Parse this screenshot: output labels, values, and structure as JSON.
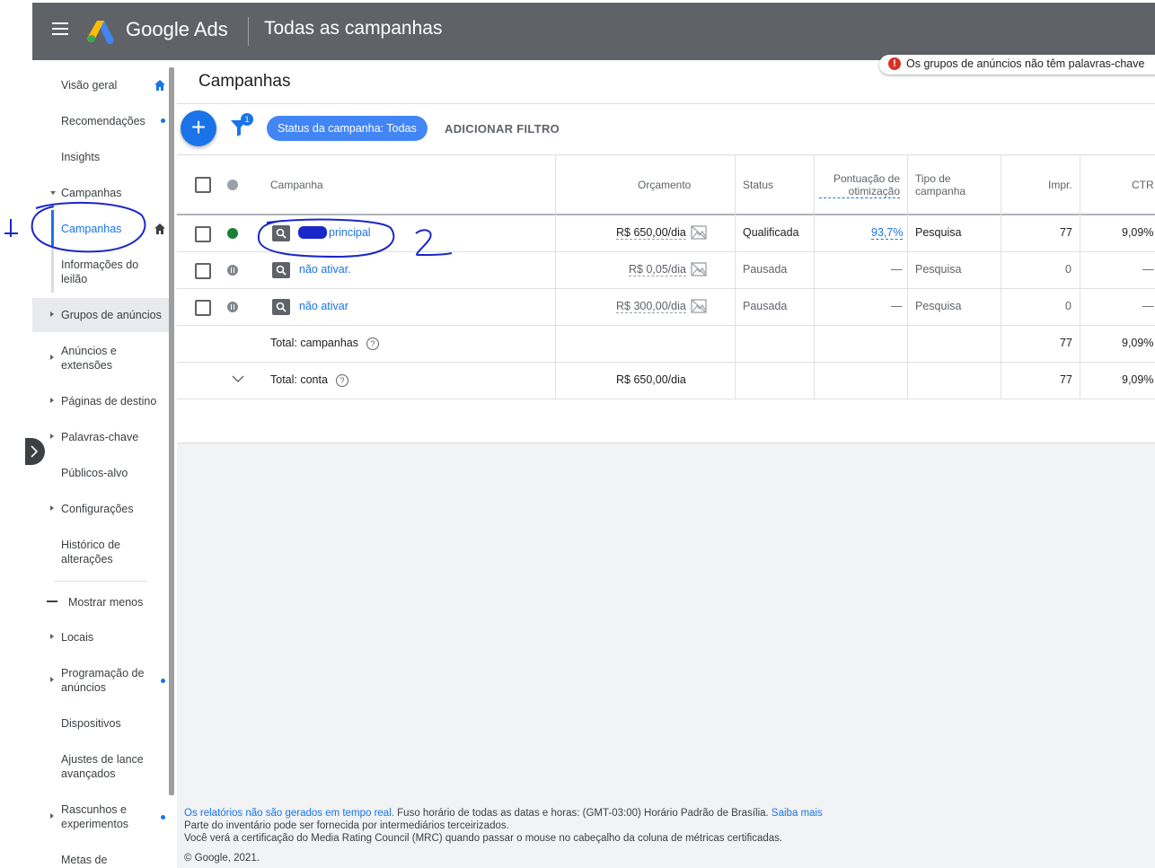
{
  "header": {
    "brand": "Google Ads",
    "page_title": "Todas as campanhas"
  },
  "toast": {
    "text": "Os grupos de anúncios não têm palavras-chave"
  },
  "sidebar": {
    "items": [
      {
        "label": "Visão geral"
      },
      {
        "label": "Recomendações"
      },
      {
        "label": "Insights"
      },
      {
        "label": "Campanhas"
      },
      {
        "label": "Campanhas"
      },
      {
        "label": "Informações do leilão"
      },
      {
        "label": "Grupos de anúncios"
      },
      {
        "label": "Anúncios e extensões"
      },
      {
        "label": "Páginas de destino"
      },
      {
        "label": "Palavras-chave"
      },
      {
        "label": "Públicos-alvo"
      },
      {
        "label": "Configurações"
      },
      {
        "label": "Histórico de alterações"
      },
      {
        "label": "Mostrar menos"
      },
      {
        "label": "Locais"
      },
      {
        "label": "Programação de anúncios"
      },
      {
        "label": "Dispositivos"
      },
      {
        "label": "Ajustes de lance avançados"
      },
      {
        "label": "Rascunhos e experimentos"
      },
      {
        "label": "Metas de"
      }
    ]
  },
  "main": {
    "title": "Campanhas",
    "add_button": "+",
    "filter_badge": "1",
    "status_chip": "Status da campanha: Todas",
    "add_filter": "ADICIONAR FILTRO"
  },
  "table": {
    "headers": {
      "campaign": "Campanha",
      "budget": "Orçamento",
      "status": "Status",
      "optimization": "Pontuação de otimização",
      "type": "Tipo de campanha",
      "impr": "Impr.",
      "ctr": "CTR"
    },
    "rows": [
      {
        "name": "principal",
        "budget": "R$ 650,00/dia",
        "status": "Qualificada",
        "optimization": "93,7%",
        "type": "Pesquisa",
        "impr": "77",
        "ctr": "9,09%"
      },
      {
        "name": "não ativar.",
        "budget": "R$ 0,05/dia",
        "status": "Pausada",
        "optimization": "—",
        "type": "Pesquisa",
        "impr": "0",
        "ctr": "—"
      },
      {
        "name": "não ativar",
        "budget": "R$ 300,00/dia",
        "status": "Pausada",
        "optimization": "—",
        "type": "Pesquisa",
        "impr": "0",
        "ctr": "—"
      }
    ],
    "total_campaigns": {
      "label": "Total: campanhas",
      "impr": "77",
      "ctr": "9,09%"
    },
    "total_account": {
      "label": "Total: conta",
      "budget": "R$ 650,00/dia",
      "impr": "77",
      "ctr": "9,09%"
    }
  },
  "footer": {
    "line1_link": "Os relatórios não são gerados em tempo real.",
    "line1_text": " Fuso horário de todas as datas e horas: (GMT-03:00) Horário Padrão de Brasília. ",
    "line1_link2": "Saiba mais",
    "line2": "Parte do inventário pode ser fornecida por intermediários terceirizados.",
    "line3": "Você verá a certificação do Media Rating Council (MRC) quando passar o mouse no cabeçalho da coluna de métricas certificadas.",
    "line4": "© Google, 2021."
  },
  "colors": {
    "topbar": "#5f6368",
    "accent": "#1a73e8",
    "qualified": "#188038",
    "annotation_ink": "#1a27c9"
  }
}
